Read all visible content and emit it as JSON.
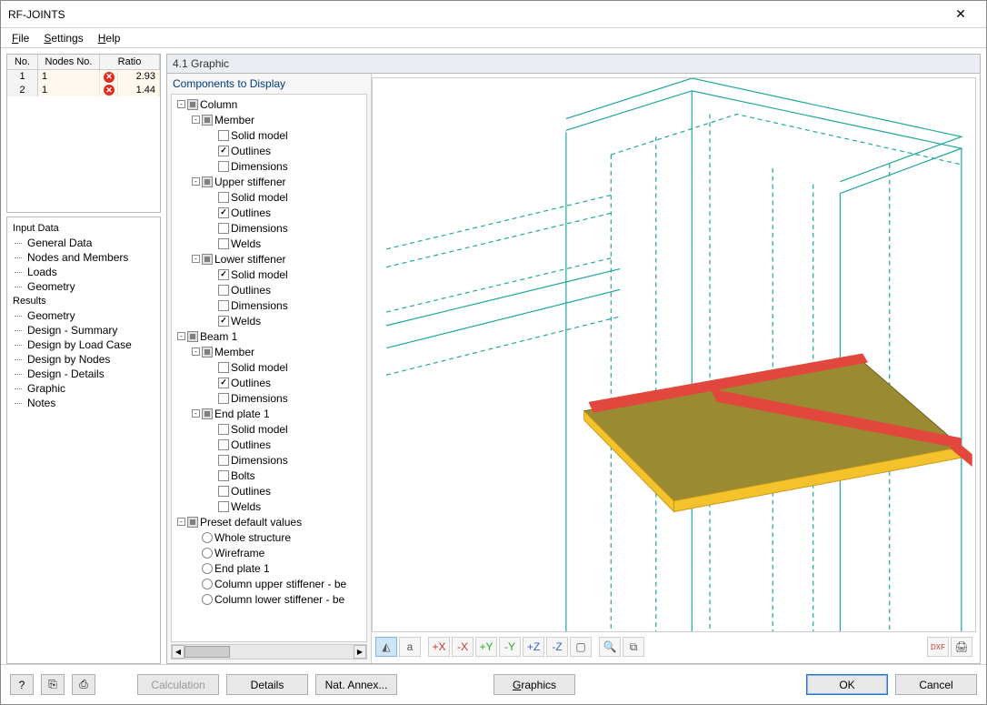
{
  "title": "RF-JOINTS",
  "menus": {
    "file": "File",
    "settings": "Settings",
    "help": "Help"
  },
  "grid": {
    "head": {
      "no": "No.",
      "nodes": "Nodes No.",
      "ratio": "Ratio"
    },
    "rows": [
      {
        "no": "1",
        "nodes": "1",
        "ratio": "2.93"
      },
      {
        "no": "2",
        "nodes": "1",
        "ratio": "1.44"
      }
    ]
  },
  "nav": {
    "input_head": "Input Data",
    "results_head": "Results",
    "input": [
      "General Data",
      "Nodes and Members",
      "Loads",
      "Geometry"
    ],
    "results": [
      "Geometry",
      "Design - Summary",
      "Design by Load Case",
      "Design by Nodes",
      "Design - Details",
      "Graphic",
      "Notes"
    ]
  },
  "right_head": "4.1 Graphic",
  "tree_head": "Components to Display",
  "tree": {
    "column": "Column",
    "beam1": "Beam 1",
    "member": "Member",
    "upper_stiffener": "Upper stiffener",
    "lower_stiffener": "Lower stiffener",
    "end_plate_1": "End plate 1",
    "solid_model": "Solid model",
    "outlines": "Outlines",
    "dimensions": "Dimensions",
    "welds": "Welds",
    "bolts": "Bolts",
    "preset": "Preset default values",
    "whole_structure": "Whole structure",
    "wireframe": "Wireframe",
    "col_upper": "Column upper stiffener - be",
    "col_lower": "Column lower stiffener - be"
  },
  "toolbar_icons": {
    "iso": "◢",
    "dim": "a",
    "xp": "+X",
    "xm": "-X",
    "yp": "+Y",
    "ym": "-Y",
    "zp": "+Z",
    "zm": "-Z",
    "box": "▢",
    "zoom": "🔍",
    "layers": "⧉",
    "dxf": "DXF",
    "print": "🖨"
  },
  "buttons": {
    "help": "?",
    "calc": "Calculation",
    "details": "Details",
    "annex": "Nat. Annex...",
    "graphics": "Graphics",
    "ok": "OK",
    "cancel": "Cancel"
  }
}
